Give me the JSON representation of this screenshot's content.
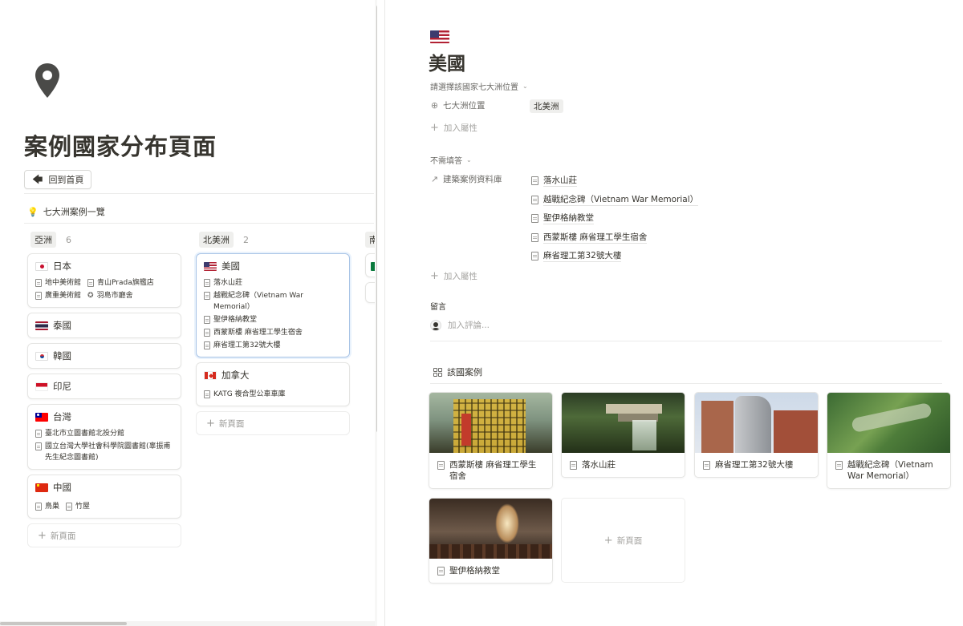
{
  "left": {
    "page_icon": "location-pin-icon",
    "title": "案例國家分布頁面",
    "home_button": "回到首頁",
    "view_title": "七大洲案例一覽",
    "columns": [
      {
        "name": "亞洲",
        "count": "6",
        "cards": [
          {
            "flag": "JP",
            "name": "日本",
            "items": [
              "地中美術館",
              "青山Prada旗艦店",
              "廣重美術館",
              "羽島市廳舍"
            ]
          },
          {
            "flag": "TH",
            "name": "泰國",
            "items": []
          },
          {
            "flag": "KR",
            "name": "韓國",
            "items": []
          },
          {
            "flag": "ID",
            "name": "印尼",
            "items": []
          },
          {
            "flag": "TW",
            "name": "台灣",
            "items": [
              "臺北市立圖書館北投分館",
              "國立台灣大學社會科學院圖書館(辜振甫先生紀念圖書館)"
            ]
          },
          {
            "flag": "CN",
            "name": "中國",
            "items": [
              "鳥巢",
              "竹屋"
            ]
          }
        ],
        "new_page": "新頁面"
      },
      {
        "name": "北美洲",
        "count": "2",
        "cards": [
          {
            "flag": "US",
            "name": "美國",
            "items": [
              "落水山莊",
              "越戰紀念碑（Vietnam War Memorial）",
              "聖伊格納教堂",
              "西蒙斯樓 麻省理工學生宿舍",
              "麻省理工第32號大樓"
            ]
          },
          {
            "flag": "CA",
            "name": "加拿大",
            "items": [
              "KATG 複合型公車車庫"
            ]
          }
        ],
        "new_page": "新頁面"
      },
      {
        "name": "南",
        "count": "",
        "cards": [],
        "new_page": ""
      }
    ]
  },
  "right": {
    "flag": "US",
    "title": "美國",
    "section1": "請選擇該國家七大洲位置",
    "prop_continent_label": "七大洲位置",
    "prop_continent_value": "北美洲",
    "add_property": "加入屬性",
    "section2": "不需填答",
    "prop_relation_label": "建築案例資料庫",
    "related": [
      "落水山莊",
      "越戰紀念碑（Vietnam War Memorial）",
      "聖伊格納教堂",
      "西蒙斯樓 麻省理工學生宿舍",
      "麻省理工第32號大樓"
    ],
    "add_property_2": "加入屬性",
    "comments_label": "留言",
    "comment_placeholder": "加入評論...",
    "gallery_title": "該國案例",
    "gallery": [
      "西蒙斯樓 麻省理工學生宿舍",
      "落水山莊",
      "麻省理工第32號大樓",
      "越戰紀念碑（Vietnam War Memorial）",
      "聖伊格納教堂"
    ],
    "gallery_new": "新頁面"
  }
}
